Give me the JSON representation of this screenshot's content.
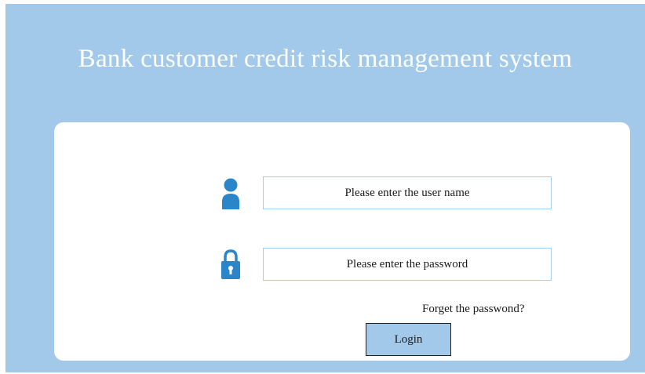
{
  "header": {
    "title": "Bank customer credit risk management system"
  },
  "login_form": {
    "username_placeholder": "Please enter the user name",
    "username_icon": "user-icon",
    "password_placeholder": "Please enter the password",
    "password_icon": "lock-icon",
    "forgot_password_label": "Forget the passwond?",
    "login_label": "Login"
  },
  "colors": {
    "background": "#a2c9ea",
    "panel": "#ffffff",
    "icon": "#2a86c8",
    "field_border": "#a9cce8"
  }
}
